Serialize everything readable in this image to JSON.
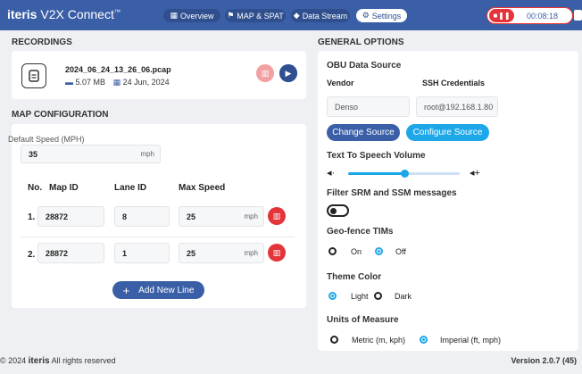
{
  "header": {
    "brand_bold": "iteris",
    "brand_rest": " V2X Connect",
    "brand_mark": "™",
    "nav": [
      {
        "label": "Overview",
        "icon": "grid-icon"
      },
      {
        "label": "MAP & SPAT",
        "icon": "traffic-icon"
      },
      {
        "label": "Data Stream",
        "icon": "stream-icon"
      },
      {
        "label": "Settings",
        "icon": "gear-icon",
        "active": true
      }
    ],
    "recording_time": "00:08:18"
  },
  "recordings": {
    "title": "RECORDINGS",
    "file_name": "2024_06_24_13_26_06.pcap",
    "file_size": "5.07 MB",
    "file_date": "24 Jun, 2024"
  },
  "map_config": {
    "title": "MAP CONFIGURATION",
    "default_speed_label": "Default Speed (MPH)",
    "default_speed_value": "35",
    "unit": "mph",
    "columns": [
      "No.",
      "Map ID",
      "Lane ID",
      "Max Speed"
    ],
    "rows": [
      {
        "no": "1.",
        "map_id": "28872",
        "lane_id": "8",
        "max_speed": "25"
      },
      {
        "no": "2.",
        "map_id": "28872",
        "lane_id": "1",
        "max_speed": "25"
      }
    ],
    "add_line_label": "Add New Line"
  },
  "general": {
    "title": "GENERAL OPTIONS",
    "obu_title": "OBU Data Source",
    "vendor_label": "Vendor",
    "vendor_value": "Denso",
    "ssh_label": "SSH Credentials",
    "ssh_value": "root@192.168.1.80",
    "change_source": "Change Source",
    "configure_source": "Configure Source",
    "tts_label": "Text To Speech Volume",
    "tts_volume": 0.5,
    "filter_label": "Filter SRM and SSM messages",
    "geofence_label": "Geo-fence TIMs",
    "geofence_on": "On",
    "geofence_off": "Off",
    "theme_label": "Theme Color",
    "theme_light": "Light",
    "theme_dark": "Dark",
    "units_label": "Units of Measure",
    "units_metric": "Metric (m, kph)",
    "units_imperial": "Imperial (ft, mph)"
  },
  "footer": {
    "copyright_prefix": "© 2024 ",
    "copyright_brand": "iteris",
    "copyright_suffix": " All rights reserved",
    "version": "Version 2.0.7 (45)"
  },
  "colors": {
    "primary": "#3a5fa6",
    "accent": "#1ea7e8",
    "danger": "#e4343a"
  }
}
